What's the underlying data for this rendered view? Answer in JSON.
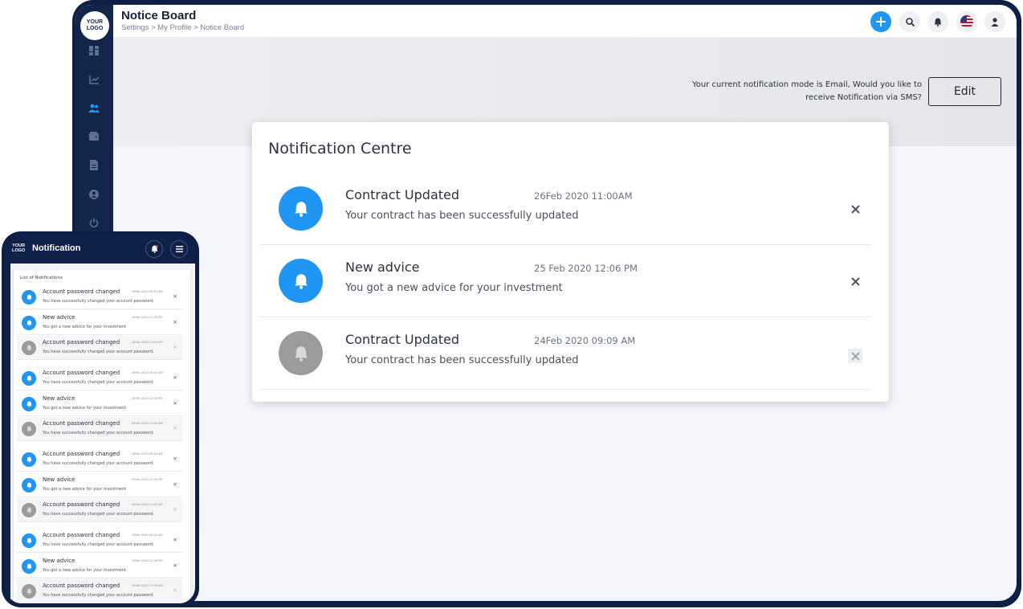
{
  "desktop": {
    "logo": [
      "YOUR",
      "LOGO"
    ],
    "sidebar_icons": [
      "dashboard-icon",
      "chart-icon",
      "users-icon",
      "wallet-icon",
      "document-icon",
      "user-circle-icon",
      "power-icon"
    ],
    "page_title": "Notice Board",
    "breadcrumb": "Settings > My Profile > Notice Board",
    "top_actions": [
      "plus-icon",
      "search-icon",
      "bell-icon",
      "us-flag-icon",
      "user-icon"
    ],
    "mode_line1": "Your current notification mode is Email, Would you like to",
    "mode_line2": "receive Notification via SMS?",
    "edit_label": "Edit",
    "card_title": "Notification Centre",
    "notifications": [
      {
        "title": "Contract Updated",
        "date": "26Feb 2020 11:00AM",
        "message": "Your contract has been successfully updated",
        "state": "unread"
      },
      {
        "title": "New advice",
        "date": "25 Feb 2020 12:06 PM",
        "message": "You got a new advice for your investment",
        "state": "unread"
      },
      {
        "title": "Contract Updated",
        "date": "24Feb 2020 09:09 AM",
        "message": "Your contract has been successfully updated",
        "state": "read"
      }
    ],
    "colors": {
      "accent": "#1f95f4",
      "sidebar": "#13254b",
      "read": "#9b9b9b"
    }
  },
  "mobile": {
    "logo": [
      "YOUR",
      "LOGO"
    ],
    "title": "Notification",
    "list_title": "List of Notifications",
    "items": [
      {
        "title": "Account password changed",
        "date": "26Feb 2020 09:25 AM",
        "message": "You have successfully changed your account password.",
        "state": "unread"
      },
      {
        "title": "New advice",
        "date": "25Feb 2020 12:06 PM",
        "message": "You got a new advice for your investment",
        "state": "unread"
      },
      {
        "title": "Account password changed",
        "date": "24Feb 2020 11:00 AM",
        "message": "You have successfully changed your account password.",
        "state": "read"
      },
      {
        "title": "Account password changed",
        "date": "26Feb 2020 09:25 AM",
        "message": "You have successfully changed your account password.",
        "state": "unread"
      },
      {
        "title": "New advice",
        "date": "25Feb 2020 12:06 PM",
        "message": "You got a new advice for your investment",
        "state": "unread"
      },
      {
        "title": "Account password changed",
        "date": "24Feb 2020 11:00 AM",
        "message": "You have successfully changed your account password.",
        "state": "read"
      },
      {
        "title": "Account password changed",
        "date": "26Feb 2020 09:25 AM",
        "message": "You have successfully changed your account password.",
        "state": "unread"
      },
      {
        "title": "New advice",
        "date": "25Feb 2020 12:06 PM",
        "message": "You got a new advice for your investment",
        "state": "unread"
      },
      {
        "title": "Account password changed",
        "date": "24Feb 2020 11:00 AM",
        "message": "You have successfully changed your account password.",
        "state": "read"
      },
      {
        "title": "Account password changed",
        "date": "26Feb 2020 09:25 AM",
        "message": "You have successfully changed your account password.",
        "state": "unread"
      },
      {
        "title": "New advice",
        "date": "25Feb 2020 12:06 PM",
        "message": "You got a new advice for your investment",
        "state": "unread"
      },
      {
        "title": "Account password changed",
        "date": "24Feb 2020 11:00 AM",
        "message": "You have successfully changed your account password.",
        "state": "read"
      }
    ]
  }
}
